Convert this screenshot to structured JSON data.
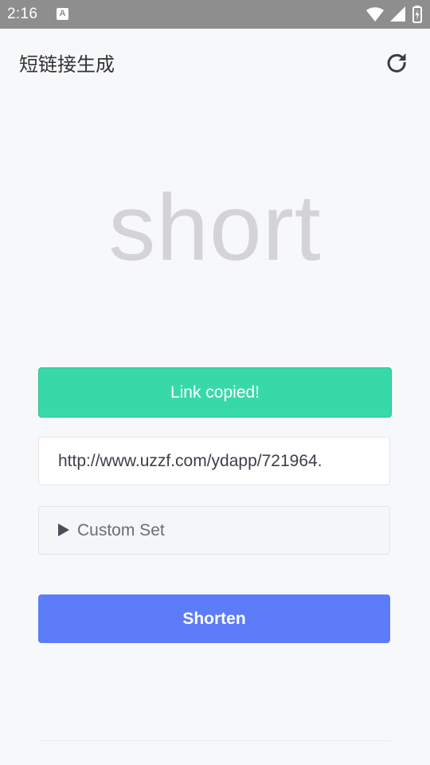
{
  "status_bar": {
    "time": "2:16",
    "notification_icon": "A",
    "icons": [
      "wifi-icon",
      "signal-icon",
      "battery-charging-icon"
    ]
  },
  "app_bar": {
    "title": "短链接生成",
    "refresh_icon": "refresh-icon"
  },
  "logo": {
    "text": "short"
  },
  "banner": {
    "text": "Link copied!",
    "color": "#38d9a9"
  },
  "url_input": {
    "value": "http://www.uzzf.com/ydapp/721964."
  },
  "custom_set": {
    "label": "Custom Set",
    "icon": "triangle-right-icon"
  },
  "shorten_button": {
    "label": "Shorten",
    "color": "#5c7cfa"
  }
}
